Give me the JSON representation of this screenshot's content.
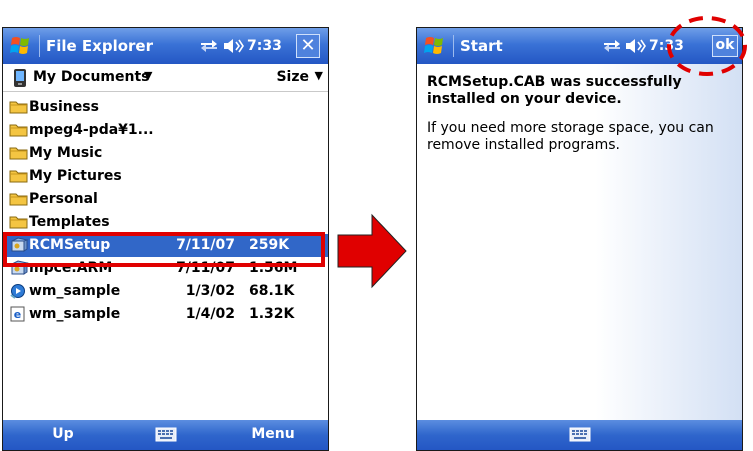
{
  "left": {
    "title": "File Explorer",
    "clock": "7:33",
    "close_label": "✕",
    "folder_name": "My Documents",
    "sort_label": "Size",
    "files": [
      {
        "name": "Business",
        "date": "",
        "size": "",
        "icon": "folder-icon"
      },
      {
        "name": "mpeg4-pda¥1...",
        "date": "",
        "size": "",
        "icon": "folder-icon"
      },
      {
        "name": "My Music",
        "date": "",
        "size": "",
        "icon": "folder-icon"
      },
      {
        "name": "My Pictures",
        "date": "",
        "size": "",
        "icon": "folder-icon"
      },
      {
        "name": "Personal",
        "date": "",
        "size": "",
        "icon": "folder-icon"
      },
      {
        "name": "Templates",
        "date": "",
        "size": "",
        "icon": "folder-icon"
      },
      {
        "name": "RCMSetup",
        "date": "7/11/07",
        "size": "259K",
        "icon": "cab-installer-icon",
        "selected": true
      },
      {
        "name": "mpce.ARM",
        "date": "7/11/07",
        "size": "1.56M",
        "icon": "cab-installer-icon"
      },
      {
        "name": "wm_sample",
        "date": "1/3/02",
        "size": "68.1K",
        "icon": "media-file-icon"
      },
      {
        "name": "wm_sample",
        "date": "1/4/02",
        "size": "1.32K",
        "icon": "ie-file-icon"
      }
    ],
    "softkey_left": "Up",
    "softkey_right": "Menu"
  },
  "right": {
    "title": "Start",
    "clock": "7:33",
    "ok_label": "ok",
    "message_bold": "RCMSetup.CAB was successfully installed on your device.",
    "message_normal": "If you need more storage space, you can remove installed programs."
  },
  "colors": {
    "titlebar": "#2f66cc",
    "selection": "#3167c8",
    "highlight_red": "#e00000",
    "arrow_red": "#e00000"
  }
}
